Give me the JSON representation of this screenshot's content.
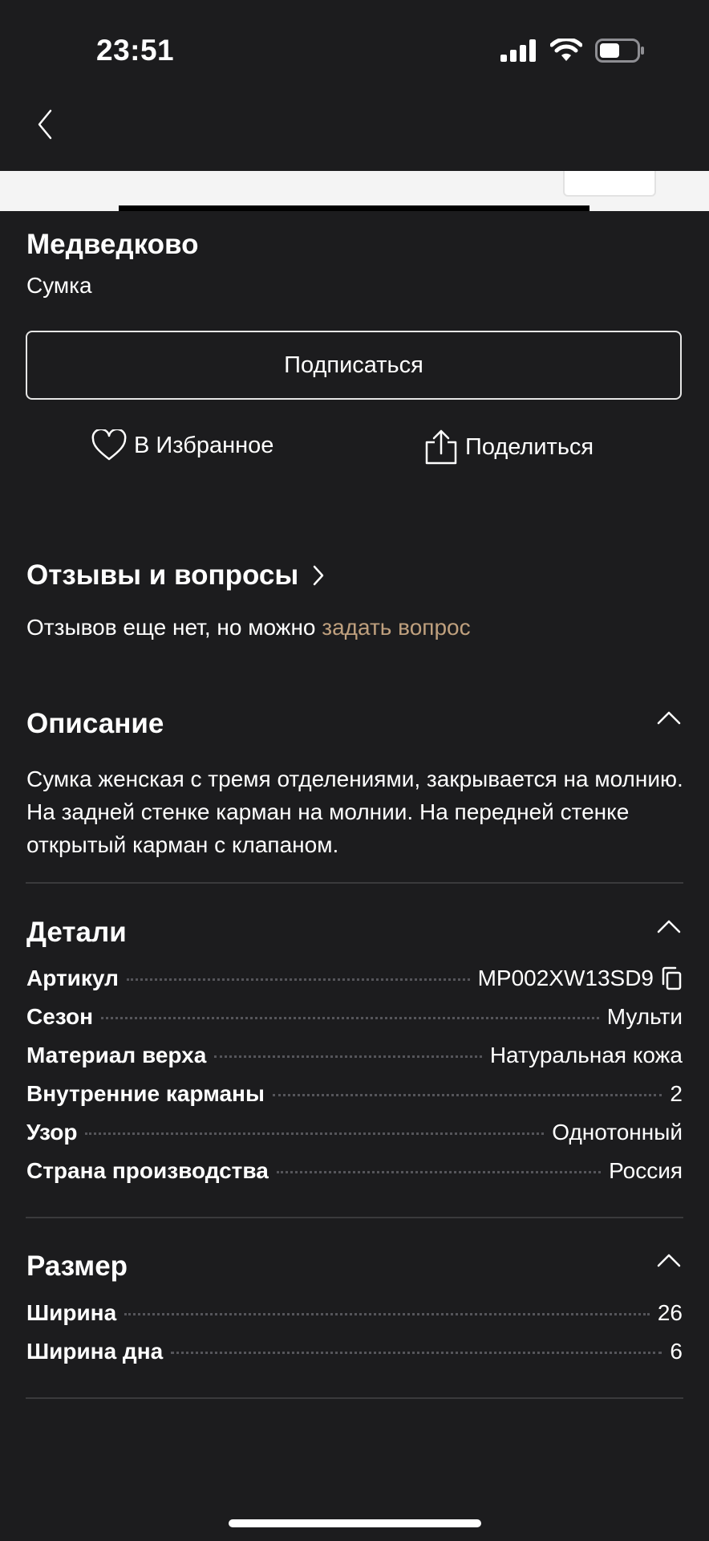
{
  "status_bar": {
    "time": "23:51"
  },
  "nav": {
    "back_icon": "chevron-left-icon"
  },
  "product": {
    "brand": "Медведково",
    "type": "Сумка",
    "subscribe_label": "Подписаться",
    "favorite_label": "В Избранное",
    "share_label": "Поделиться"
  },
  "reviews": {
    "title": "Отзывы и вопросы",
    "empty_text": "Отзывов еще нет, но можно ",
    "ask_link": "задать вопрос"
  },
  "description": {
    "title": "Описание",
    "text": "Сумка женская с тремя отделениями, закрывается на молнию. На задней стенке карман на молнии. На передней стенке открытый карман с клапаном."
  },
  "details": {
    "title": "Детали",
    "rows": [
      {
        "label": "Артикул",
        "value": "MP002XW13SD9"
      },
      {
        "label": "Сезон",
        "value": "Мульти"
      },
      {
        "label": "Материал верха",
        "value": "Натуральная кожа"
      },
      {
        "label": "Внутренние карманы",
        "value": "2"
      },
      {
        "label": "Узор",
        "value": "Однотонный"
      },
      {
        "label": "Страна производства",
        "value": "Россия"
      }
    ]
  },
  "size": {
    "title": "Размер",
    "rows": [
      {
        "label": "Ширина",
        "value": "26"
      },
      {
        "label": "Ширина дна",
        "value": "6"
      }
    ]
  },
  "colors": {
    "background": "#1c1c1e",
    "link_accent": "#bfa07e",
    "divider": "#3a3a3c"
  }
}
